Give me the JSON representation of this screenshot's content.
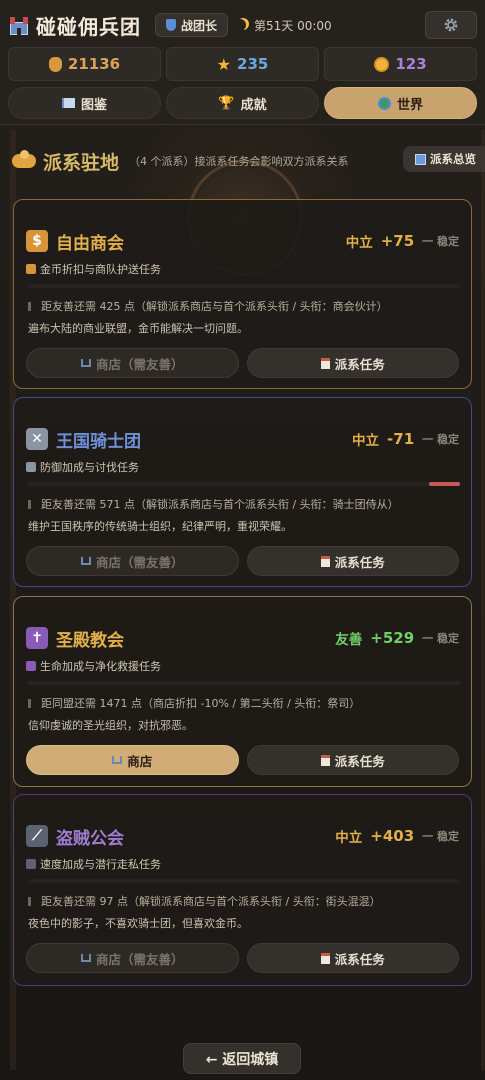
{
  "header": {
    "app_title": "碰碰佣兵团",
    "rank": "战团长",
    "day": "第51天 00:00"
  },
  "resources": [
    {
      "icon": "money-bag-icon",
      "value": "21136",
      "color": "#d9a45a"
    },
    {
      "icon": "star-icon",
      "value": "235",
      "color": "#6fa8e0"
    },
    {
      "icon": "coin-icon",
      "value": "123",
      "color": "#a882d9"
    }
  ],
  "tabs": [
    {
      "label": "图鉴",
      "icon": "book-icon",
      "active": false
    },
    {
      "label": "成就",
      "icon": "trophy-icon",
      "active": false
    },
    {
      "label": "世界",
      "icon": "globe-icon",
      "active": true
    }
  ],
  "section": {
    "title": "派系驻地",
    "subtitle": "（4 个派系）接派系任务会影响双方派系关系",
    "overview_label": "派系总览"
  },
  "factions": [
    {
      "name": "自由商会",
      "icon": "money-bag-icon",
      "icon_glyph": "$",
      "name_color": "#e2b04a",
      "border_color": "#8a6a30",
      "relation_label": "中立",
      "relation_value": "+75",
      "relation_color": "#e2b04a",
      "trend": "一 稳定",
      "perk": "金币折扣与商队护送任务",
      "goal": "距友善还需 425 点（解锁派系商店与首个派系头衔 / 头衔：商会伙计）",
      "description": "遍布大陆的商业联盟，金币能解决一切问题。",
      "rep_fraction": 0.5,
      "shop_label": "商店（需友善）",
      "shop_enabled": false,
      "quest_label": "派系任务"
    },
    {
      "name": "王国骑士团",
      "icon": "crossed-swords-icon",
      "icon_glyph": "✕",
      "name_color": "#6f8fd6",
      "border_color": "#3d4f86",
      "relation_label": "中立",
      "relation_value": "-71",
      "relation_color": "#e2b04a",
      "trend": "一 稳定",
      "perk": "防御加成与讨伐任务",
      "goal": "距友善还需 571 点（解锁派系商店与首个派系头衔 / 头衔：骑士团侍从）",
      "description": "维护王国秩序的传统骑士组织，纪律严明，重视荣耀。",
      "rep_fraction": -0.07,
      "shop_label": "商店（需友善）",
      "shop_enabled": false,
      "quest_label": "派系任务"
    },
    {
      "name": "圣殿教会",
      "icon": "holy-cross-icon",
      "icon_glyph": "✝",
      "name_color": "#e2b04a",
      "border_color": "#8a7640",
      "relation_label": "友善",
      "relation_value": "+529",
      "relation_color": "#6fd06a",
      "trend": "一 稳定",
      "perk": "生命加成与净化救援任务",
      "goal": "距同盟还需 1471 点（商店折扣 -10% / 第二头衔 / 头衔：祭司）",
      "description": "信仰虔诚的圣光组织，对抗邪恶。",
      "rep_fraction": 0.53,
      "shop_label": "商店",
      "shop_enabled": true,
      "quest_label": "派系任务"
    },
    {
      "name": "盗贼公会",
      "icon": "dagger-icon",
      "icon_glyph": "⟋",
      "name_color": "#a07cd0",
      "border_color": "#4e3d6e",
      "relation_label": "中立",
      "relation_value": "+403",
      "relation_color": "#e2b04a",
      "trend": "一 稳定",
      "perk": "速度加成与潜行走私任务",
      "goal": "距友善还需 97 点（解锁派系商店与首个派系头衔 / 头衔：街头混混）",
      "description": "夜色中的影子，不喜欢骑士团，但喜欢金币。",
      "rep_fraction": 0.8,
      "shop_label": "商店（需友善）",
      "shop_enabled": false,
      "quest_label": "派系任务"
    }
  ],
  "footer": {
    "back_label": "← 返回城镇"
  }
}
